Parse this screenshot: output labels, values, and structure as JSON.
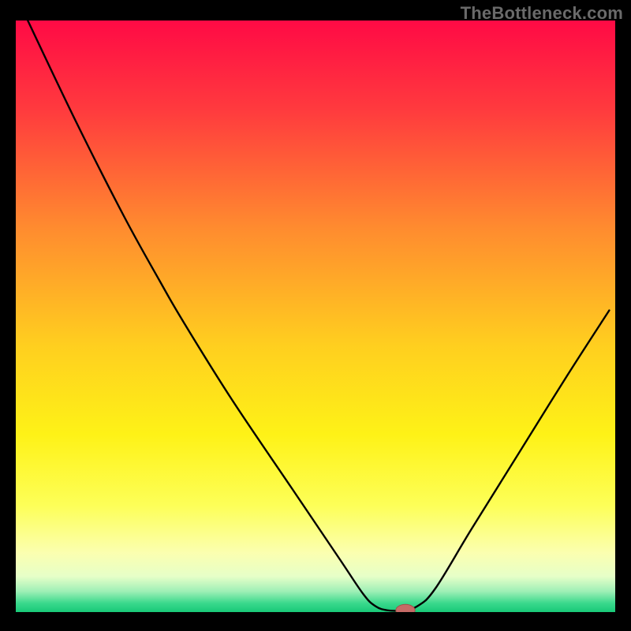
{
  "watermark": "TheBottleneck.com",
  "colors": {
    "bg": "#000000",
    "curve": "#000000",
    "marker_fill": "#c66a66",
    "marker_stroke": "#a04e4a"
  },
  "chart_data": {
    "type": "line",
    "title": "",
    "xlabel": "",
    "ylabel": "",
    "xlim": [
      0,
      100
    ],
    "ylim": [
      0,
      100
    ],
    "grid": false,
    "background_gradient_stops": [
      {
        "pos": 0.0,
        "color": "#ff0a45"
      },
      {
        "pos": 0.15,
        "color": "#ff3a3e"
      },
      {
        "pos": 0.35,
        "color": "#ff8b2f"
      },
      {
        "pos": 0.55,
        "color": "#ffcf1f"
      },
      {
        "pos": 0.7,
        "color": "#fef217"
      },
      {
        "pos": 0.82,
        "color": "#fdff58"
      },
      {
        "pos": 0.9,
        "color": "#fbffb0"
      },
      {
        "pos": 0.94,
        "color": "#e6ffc8"
      },
      {
        "pos": 0.965,
        "color": "#9eefb6"
      },
      {
        "pos": 0.985,
        "color": "#3ad98c"
      },
      {
        "pos": 1.0,
        "color": "#18c978"
      }
    ],
    "series": [
      {
        "name": "bottleneck-curve",
        "points": [
          {
            "x": 2.0,
            "y": 100.0
          },
          {
            "x": 10.0,
            "y": 83.0
          },
          {
            "x": 18.0,
            "y": 67.0
          },
          {
            "x": 24.0,
            "y": 56.0
          },
          {
            "x": 28.0,
            "y": 49.0
          },
          {
            "x": 36.0,
            "y": 36.0
          },
          {
            "x": 46.0,
            "y": 21.0
          },
          {
            "x": 54.0,
            "y": 9.0
          },
          {
            "x": 58.0,
            "y": 3.0
          },
          {
            "x": 60.0,
            "y": 1.0
          },
          {
            "x": 62.0,
            "y": 0.3
          },
          {
            "x": 64.5,
            "y": 0.3
          },
          {
            "x": 67.0,
            "y": 1.0
          },
          {
            "x": 70.0,
            "y": 4.0
          },
          {
            "x": 76.0,
            "y": 14.0
          },
          {
            "x": 84.0,
            "y": 27.0
          },
          {
            "x": 92.0,
            "y": 40.0
          },
          {
            "x": 99.0,
            "y": 51.0
          }
        ]
      }
    ],
    "marker": {
      "x": 65.0,
      "y": 0.3,
      "rx": 1.6,
      "ry": 1.0
    }
  }
}
